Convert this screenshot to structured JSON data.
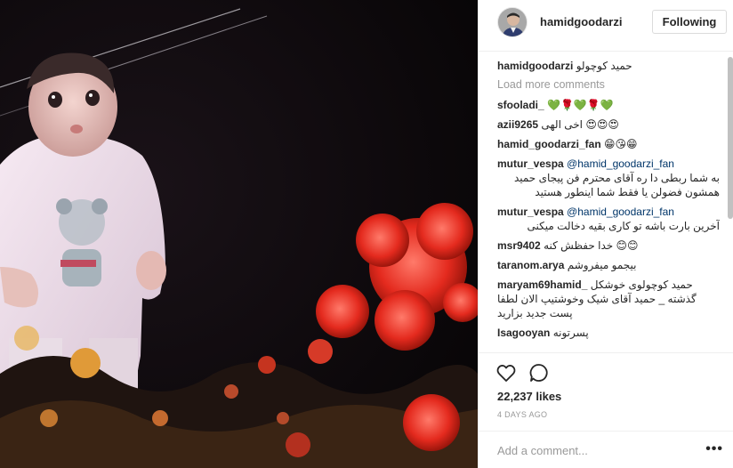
{
  "post": {
    "username": "hamidgoodarzi",
    "follow_label": "Following",
    "caption_author": "hamidgoodarzi",
    "caption_text": "حمید کوچولو",
    "load_more": "Load more comments",
    "likes": "22,237 likes",
    "time": "4 DAYS AGO",
    "add_comment_placeholder": "Add a comment...",
    "more_options": "•••"
  },
  "comments": [
    {
      "author": "sfooladi_",
      "mention": "",
      "text": "💚🌹💚🌹💚"
    },
    {
      "author": "azii9265",
      "mention": "",
      "text": "اخی الهی 😍😍😍"
    },
    {
      "author": "hamid_goodarzi_fan",
      "mention": "",
      "text": "😁😘😁"
    },
    {
      "author": "mutur_vespa",
      "mention": "@hamid_goodarzi_fan",
      "text": "به شما ربطی دا ره آقای محترم فن پیجای حمید همشون فضولن یا فقط شما اینطور هستید"
    },
    {
      "author": "mutur_vespa",
      "mention": "@hamid_goodarzi_fan",
      "text": "آخرین بارت باشه تو کاری بقیه دخالت میکنی"
    },
    {
      "author": "msr9402",
      "mention": "",
      "text": "خدا حفظش کنه 😊😊"
    },
    {
      "author": "taranom.arya",
      "mention": "",
      "text": "بیجمو میفروشم"
    },
    {
      "author": "maryam69hamid_",
      "mention": "",
      "text": "حمید کوچولوی خوشکل گذشته _ حمید آقای شیک وخوشتیپ الان لطفا پست جدید بزارید"
    },
    {
      "author": "Isagooyan",
      "mention": "",
      "text": "پسرتونه"
    }
  ],
  "icons": {
    "heart": "heart-icon",
    "comment": "comment-icon",
    "more": "more-options-icon"
  }
}
